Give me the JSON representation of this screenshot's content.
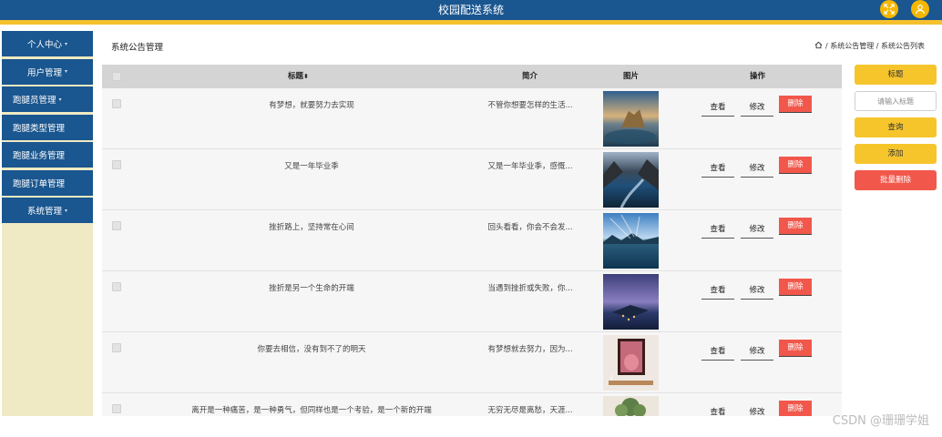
{
  "header": {
    "title": "校园配送系统",
    "fullscreen_icon": "fullscreen-icon",
    "user_icon": "user-icon"
  },
  "sidebar": {
    "items": [
      {
        "label": "个人中心",
        "caret": "▾"
      },
      {
        "label": "用户管理",
        "caret": "▾"
      },
      {
        "label": "跑腿员管理",
        "caret": "▾"
      },
      {
        "label": "跑腿类型管理",
        "caret": ""
      },
      {
        "label": "跑腿业务管理",
        "caret": ""
      },
      {
        "label": "跑腿订单管理",
        "caret": ""
      },
      {
        "label": "系统管理",
        "caret": "▾"
      }
    ]
  },
  "breadcrumb": {
    "page_title": "系统公告管理",
    "path": "/ 系统公告管理 / 系统公告列表"
  },
  "table": {
    "headers": {
      "title": "标题",
      "sort": "⬍",
      "intro": "简介",
      "image": "图片",
      "ops": "操作"
    },
    "rows": [
      {
        "title": "有梦想，就要努力去实现",
        "intro": "不管你想要怎样的生活..."
      },
      {
        "title": "又是一年毕业季",
        "intro": "又是一年毕业季，感慨..."
      },
      {
        "title": "挫折路上，坚持常在心间",
        "intro": "回头看看，你会不会发..."
      },
      {
        "title": "挫折是另一个生命的开端",
        "intro": "当遇到挫折或失败，你..."
      },
      {
        "title": "你要去相信，没有到不了的明天",
        "intro": "有梦想就去努力，因为..."
      },
      {
        "title": "离开是一种痛苦，是一种勇气，但同样也是一个考验，是一个新的开端",
        "intro": "无穷无尽是离愁，天涯..."
      }
    ],
    "op_labels": {
      "view": "查看",
      "edit": "修改",
      "delete": "删除"
    }
  },
  "actions": {
    "title_label": "标题",
    "search_placeholder": "请输入标题",
    "query": "查询",
    "add": "添加",
    "batch_delete": "批量删除"
  },
  "watermark": "CSDN @珊珊学姐",
  "colors": {
    "header_blue": "#1a568f",
    "accent_yellow": "#f5c12e",
    "danger_red": "#f2574b",
    "sidebar_bg": "#efeac3"
  }
}
